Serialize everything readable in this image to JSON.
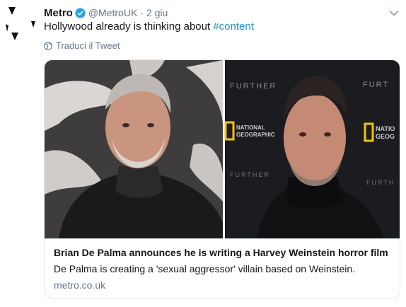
{
  "tweet": {
    "author_name": "Metro",
    "author_handle": "@MetroUK",
    "separator": "·",
    "timestamp": "2 giu",
    "text_plain": "Hollywood already is thinking about ",
    "hashtag": "#content",
    "translate_label": "Traduci il Tweet",
    "avatar_icon": "metro-logo-icon",
    "menu_icon": "chevron-down-icon"
  },
  "card": {
    "image_wall_text": {
      "further_left": "FURTHER",
      "further_right": "FURT",
      "further_bottom_left": "FURTHER",
      "further_bottom_right": "FURTH",
      "natgeo_left": [
        "NATIONAL",
        "GEOGRAPHIC"
      ],
      "natgeo_right": [
        "NATIO",
        "GEOG"
      ]
    },
    "title": "Brian De Palma announces he is writing a Harvey Weinstein horror film",
    "description": "De Palma is creating a 'sexual aggressor' villain based on Weinstein.",
    "domain": "metro.co.uk"
  },
  "colors": {
    "link": "#1b95e0",
    "secondary_text": "#657786",
    "verified": "#1da1f2",
    "border": "#e1e8ed",
    "natgeo_yellow": "#f5c400"
  }
}
